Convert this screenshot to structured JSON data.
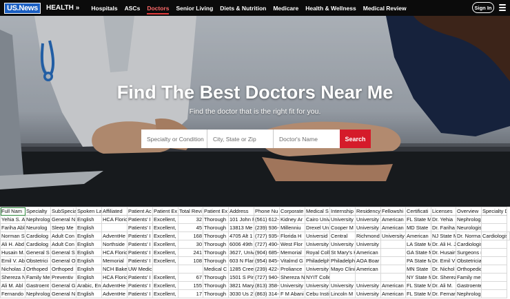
{
  "nav": {
    "logo_text": "US.News",
    "section_label": "HEALTH",
    "section_chevron": "»",
    "links": [
      {
        "label": "Hospitals",
        "active": false
      },
      {
        "label": "ASCs",
        "active": false
      },
      {
        "label": "Doctors",
        "active": true
      },
      {
        "label": "Senior Living",
        "active": false
      },
      {
        "label": "Diets & Nutrition",
        "active": false
      },
      {
        "label": "Medicare",
        "active": false
      },
      {
        "label": "Health & Wellness",
        "active": false
      },
      {
        "label": "Medical Review",
        "active": false
      }
    ],
    "signin_label": "Sign In",
    "menu_icon": "hamburger-menu-icon"
  },
  "hero": {
    "title": "Find The Best Doctors Near Me",
    "subtitle": "Find the doctor that is the right fit for you.",
    "search": {
      "specialty_placeholder": "Specialty or Condition",
      "location_placeholder": "City, State or Zip",
      "name_placeholder": "Doctor's Name",
      "button_label": "Search"
    }
  },
  "table": {
    "columns": [
      "Full Nam",
      "Specialty",
      "SubSpecia",
      "Spoken La",
      "Affiliated",
      "Patient Ac",
      "Patient Ex",
      "Total Revi",
      "Patient Ex",
      "Address",
      "Phone Nu",
      "Corporate",
      "Medical S",
      "Internship",
      "Residency",
      "Fellowshi",
      "Certificati",
      "Licenses",
      "Overview",
      "Specialty Deta"
    ],
    "rows": [
      [
        "Yehia S. A",
        "Nephrolog",
        "General N",
        "English",
        "HCA Floric",
        "Patients' I",
        "Excellent,",
        "32",
        "Thorough",
        "101 John F",
        "(561) 612-",
        "Kidney Ar",
        "Cairo Univ",
        "University Sch",
        "University",
        "American",
        "FL State M",
        "Dr. Yehia",
        "Nephrologist"
      ],
      [
        "Fariha Abl",
        "Neurolog",
        "Sleep Me",
        "English",
        "",
        "Patients' I",
        "Excellent,",
        "45",
        "Thorough",
        "13813 Me",
        "(239) 936-",
        "Millenniu",
        "Drexel Un",
        "Cooper M",
        "University",
        "American",
        "MD State",
        "Dr. Fariha",
        "Neurologists"
      ],
      [
        "Norman S",
        "Cardiolog",
        "Adult Con",
        "English",
        "AdventHe",
        "Patients' I",
        "Excellent,",
        "168",
        "Thorough",
        "4705 Alt 1",
        "(727) 935-",
        "Florida H",
        "Universid",
        "Central",
        "Richmond",
        "University",
        "American",
        "NJ State M",
        "Dr. Norma",
        "Cardiologists"
      ],
      [
        "Ali H. Abd",
        "Cardiolog",
        "Adult Con",
        "English",
        "Northside",
        "Patients' I",
        "Excellent,",
        "30",
        "Thorough",
        "6006 49th",
        "(727) 490-",
        "West Flor",
        "University of Baghd",
        "University",
        "University of Toledo",
        "",
        "LA State M",
        "Dr. Ali H. J",
        "Cardiologists"
      ],
      [
        "Husain M.",
        "General S",
        "General S",
        "English",
        "HCA Floric",
        "Patients' I",
        "Excellent,",
        "241",
        "Thorough",
        "3627, Univ",
        "(904) 685-",
        "Memorial",
        "Royal College of Surg",
        "St Mary's Hospital (W",
        "American",
        "",
        "GA State M",
        "Dr. Husain",
        "Surgeons repa"
      ],
      [
        "Emil V. Ab",
        "Obstetrici",
        "General O",
        "English",
        "Memorial",
        "Patients' I",
        "Excellent,",
        "108",
        "Thorough",
        "603 N Flan",
        "(954) 845-",
        "Vitalmd G",
        "Philadelphia College",
        "Philadelphia College",
        "AOA Boar",
        "",
        "PA State M",
        "Dr. Emil V",
        "Obstetrician-g"
      ],
      [
        "Nicholas J",
        "Orthoped",
        "Orthoped",
        "English",
        "NCH Baker Hospital,",
        "UW Medicine-Valley",
        "",
        "",
        "Medical C",
        "1285 Cree",
        "(239) 422-",
        "Proliance",
        "University of Wiscor",
        "Mayo Clinic College",
        "American",
        "",
        "MN State",
        "Dr. Nichol",
        "Orthopedic su"
      ],
      [
        "Shereza N",
        "Family Me",
        "Preventiv",
        "English",
        "HCA Floric",
        "Patients' I",
        "Excellent,",
        "67",
        "Thorough",
        "1501 S Pin",
        "(727) 940-",
        "Shereza N",
        "NYIT College of Osteopathic Medicine",
        "",
        "",
        "",
        "NY State M",
        "Dr. Sherez",
        "Family medic"
      ],
      [
        "Ali M. Abl",
        "Gastroent",
        "General G",
        "Arabic, En",
        "AdventHe",
        "Patients' I",
        "Excellent,",
        "155",
        "Thorough",
        "3821 Mary",
        "(813) 358-",
        "University",
        "University of Baghd",
        "University",
        "University",
        "American",
        "FL State M",
        "Dr. Ali M.",
        "Gastroentero"
      ],
      [
        "Fernando",
        "Nephrolog",
        "General N",
        "English",
        "AdventHe",
        "Patients' I",
        "Excellent,",
        "17",
        "Thorough",
        "3030 Us 27",
        "(863) 314-",
        "F M Abani",
        "Cebu Institute of Me",
        "Lincoln M",
        "University",
        "American",
        "FL State M",
        "Dr. Fernar",
        "Nephrologists"
      ]
    ]
  }
}
